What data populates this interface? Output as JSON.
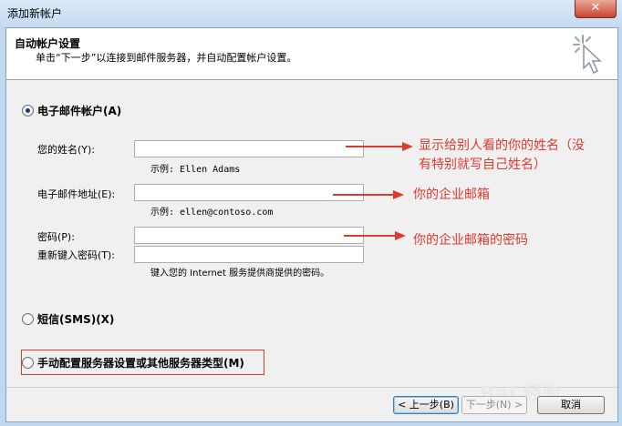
{
  "window": {
    "title": "添加新帐户",
    "close_label": "✕"
  },
  "header": {
    "title": "自动帐户设置",
    "subtitle": "单击“下一步”以连接到邮件服务器，并自动配置帐户设置。",
    "icon": "cursor-sparkle-icon"
  },
  "email_account": {
    "label": "电子邮件帐户(A)",
    "selected": true,
    "name_label": "您的姓名(Y):",
    "name_value": "",
    "name_example": "示例: Ellen Adams",
    "email_label": "电子邮件地址(E):",
    "email_value": "",
    "email_example": "示例: ellen@contoso.com",
    "password_label": "密码(P):",
    "password_value": "",
    "retype_label": "重新键入密码(T):",
    "retype_value": "",
    "password_hint": "键入您的 Internet 服务提供商提供的密码。"
  },
  "sms": {
    "label": "短信(SMS)(X)",
    "selected": false
  },
  "manual": {
    "label": "手动配置服务器设置或其他服务器类型(M)",
    "selected": false
  },
  "annotations": {
    "name_note_line1": "显示给别人看的你的姓名（没",
    "name_note_line2": "有特别就写自己姓名）",
    "email_note": "你的企业邮箱",
    "password_note": "你的企业邮箱的密码",
    "color": "#e03a2f"
  },
  "buttons": {
    "back": "< 上一步(B)",
    "next": "下一步(N) >",
    "cancel": "取消"
  },
  "watermark": "Bai 经验"
}
